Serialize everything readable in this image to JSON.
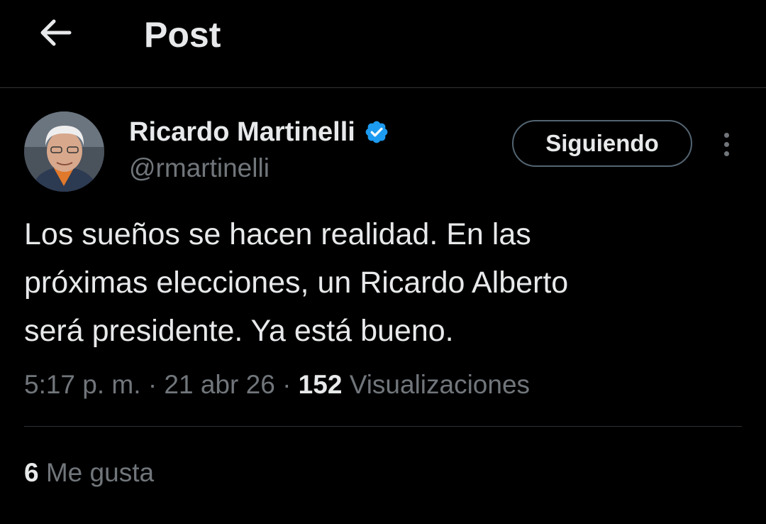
{
  "header": {
    "title": "Post"
  },
  "author": {
    "name": "Ricardo Martinelli",
    "handle": "@rmartinelli",
    "verified": true,
    "verified_color": "#1d9bf0"
  },
  "follow_button": {
    "label": "Siguiendo"
  },
  "post": {
    "text": "Los sueños se hacen realidad. En las\npróximas elecciones, un Ricardo Alberto\nserá presidente. Ya está bueno.",
    "time": "5:17 p. m.",
    "separator": "·",
    "date": "21 abr 26",
    "views_count": "152",
    "views_label": "Visualizaciones"
  },
  "engagement": {
    "likes_count": "6",
    "likes_label": "Me gusta"
  },
  "icons": {
    "back": "arrow-left-icon",
    "verified": "verified-badge-icon",
    "more": "more-vertical-icon"
  },
  "colors": {
    "background": "#000000",
    "text_primary": "#e7e9ea",
    "text_secondary": "#71767b",
    "border": "#2f3336"
  }
}
